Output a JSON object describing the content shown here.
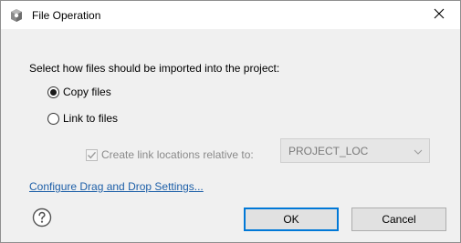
{
  "window": {
    "title": "File Operation",
    "close_icon": "close-icon",
    "app_icon": "gear-cube-icon"
  },
  "prompt": "Select how files should be imported into the project:",
  "options": {
    "copy": {
      "label": "Copy files",
      "selected": true
    },
    "link": {
      "label": "Link to files",
      "selected": false
    }
  },
  "relative": {
    "checkbox_label": "Create link locations relative to:",
    "checked": true,
    "enabled": false,
    "select_value": "PROJECT_LOC"
  },
  "config_link": "Configure Drag and Drop Settings...",
  "buttons": {
    "help_icon": "help-icon",
    "ok": "OK",
    "cancel": "Cancel"
  },
  "colors": {
    "link": "#1d5fa8",
    "ok_border": "#0078d7",
    "dialog_bg": "#f0f0f0"
  }
}
